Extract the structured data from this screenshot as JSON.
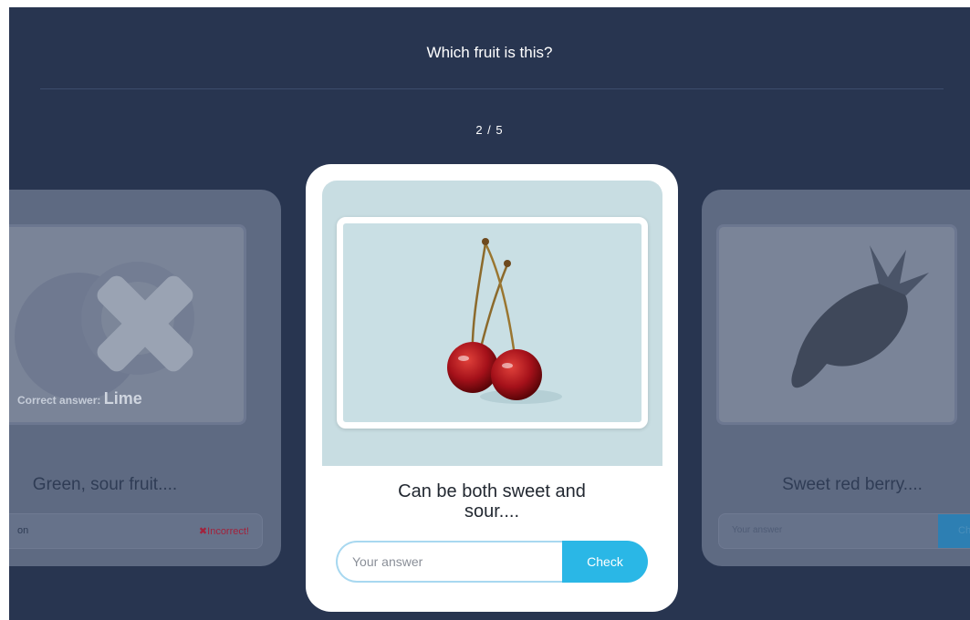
{
  "header": {
    "title": "Which fruit is this?",
    "counter": "2 / 5"
  },
  "left_card": {
    "icon": "x-mark-icon",
    "correct_answer_label": "Correct answer:",
    "correct_answer_value": "Lime",
    "description": "Green, sour fruit....",
    "answer_value": "on",
    "status": "✖Incorrect!"
  },
  "main_card": {
    "image": "cherries-image",
    "description_line1": "Can be both sweet and",
    "description_line2": "sour....",
    "input_placeholder": "Your answer",
    "check_label": "Check"
  },
  "right_card": {
    "image": "strawberry-image",
    "description": "Sweet red berry....",
    "input_placeholder": "Your answer",
    "check_label": "Ch"
  },
  "colors": {
    "background": "#283550",
    "accent": "#2ab7e6",
    "incorrect": "#a2223c"
  }
}
